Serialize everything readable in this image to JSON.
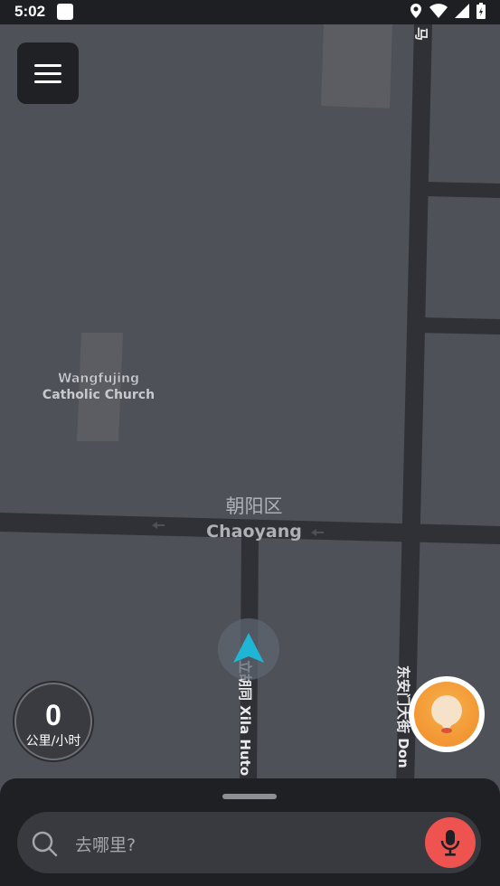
{
  "status_bar": {
    "time": "5:02"
  },
  "map": {
    "poi_label_line1": "Wangfujing",
    "poi_label_line2": "Catholic Church",
    "district_cn": "朝阳区",
    "district_en": "Chaoyang",
    "street_left": "立胡同 Xila Huto",
    "street_right": "东安门大街 Don",
    "street_top": "马",
    "road_color": "#303136",
    "block_color": "#5b5d63"
  },
  "speedometer": {
    "value": "0",
    "unit": "公里/小时"
  },
  "search": {
    "placeholder": "去哪里?"
  },
  "colors": {
    "accent_orange": "#f08a2a",
    "mic_red": "#ef5350",
    "nav_arrow": "#1fb6d6"
  }
}
